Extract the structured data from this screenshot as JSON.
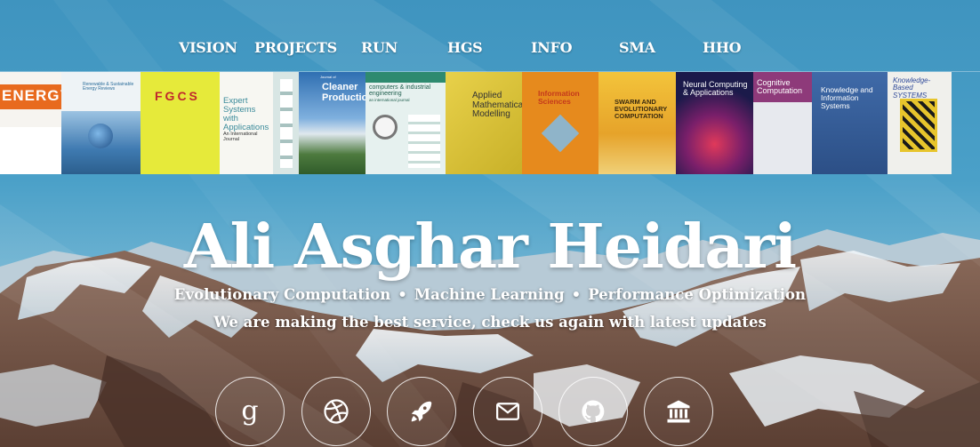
{
  "nav": {
    "items": [
      {
        "label": "VISION"
      },
      {
        "label": "PROJECTS"
      },
      {
        "label": "RUN"
      },
      {
        "label": "HGS"
      },
      {
        "label": "INFO"
      },
      {
        "label": "SMA"
      },
      {
        "label": "HHO"
      }
    ]
  },
  "journals": [
    {
      "title": "ENERGY",
      "sub": ""
    },
    {
      "title": "",
      "sub": "Renewable & Sustainable Energy Reviews"
    },
    {
      "title": "FGCS",
      "sub": ""
    },
    {
      "title": "Expert Systems with Applications",
      "sub": "An International Journal"
    },
    {
      "title": "",
      "sub": ""
    },
    {
      "title": "Cleaner Production",
      "sub": "Journal of"
    },
    {
      "title": "computers & industrial engineering",
      "sub": "an international journal"
    },
    {
      "title": "Applied Mathematical Modelling",
      "sub": ""
    },
    {
      "title": "Information Sciences",
      "sub": ""
    },
    {
      "title": "SWARM AND EVOLUTIONARY COMPUTATION",
      "sub": ""
    },
    {
      "title": "Neural Computing & Applications",
      "sub": ""
    },
    {
      "title": "Cognitive Computation",
      "sub": ""
    },
    {
      "title": "Knowledge and Information Systems",
      "sub": ""
    },
    {
      "title": "Knowledge-Based SYSTEMS",
      "sub": ""
    }
  ],
  "hero": {
    "title": "Ali Asghar Heidari",
    "topics": [
      "Evolutionary Computation",
      "Machine Learning",
      "Performance Optimization"
    ],
    "separator": "•",
    "tagline": "We are making the best service, check us again with latest updates"
  },
  "social": {
    "icons": [
      "google-scholar-icon",
      "dribbble-icon",
      "rocket-icon",
      "envelope-icon",
      "github-icon",
      "institution-icon"
    ]
  },
  "colors": {
    "sky": "#4aa0c8",
    "text": "#ffffff"
  }
}
